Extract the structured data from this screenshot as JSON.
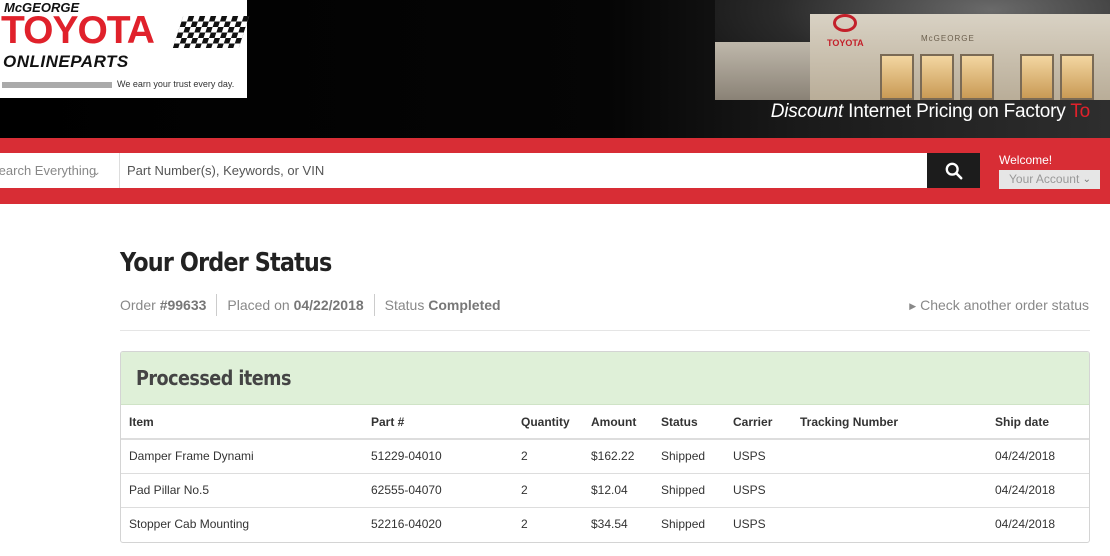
{
  "brand": {
    "dealer_name": "McGEORGE",
    "make": "TOYOTA",
    "site": "ONLINEPARTS",
    "tagline": "We earn your trust every day.",
    "building_sign": "TOYOTA",
    "building_sign_2": "McGEORGE"
  },
  "slogan": {
    "emphasis": "Discount",
    "text": " Internet Pricing on Factory ",
    "red_text": "To"
  },
  "search": {
    "category": "Search Everything",
    "placeholder": "Part Number(s), Keywords, or VIN",
    "button_icon": "search-icon"
  },
  "account": {
    "welcome": "Welcome!",
    "menu_label": "Your Account"
  },
  "page": {
    "title": "Your Order Status",
    "order_label": "Order ",
    "order_number": "#99633",
    "placed_label": "Placed on ",
    "placed_date": "04/22/2018",
    "status_label": "Status ",
    "status_value": "Completed",
    "check_link": "Check another order status"
  },
  "panel": {
    "title": "Processed items",
    "columns": [
      "Item",
      "Part #",
      "Quantity",
      "Amount",
      "Status",
      "Carrier",
      "Tracking Number",
      "Ship date"
    ],
    "rows": [
      [
        "Damper Frame Dynami",
        "51229-04010",
        "2",
        "$162.22",
        "Shipped",
        "USPS",
        "",
        "04/24/2018"
      ],
      [
        "Pad Pillar No.5",
        "62555-04070",
        "2",
        "$12.04",
        "Shipped",
        "USPS",
        "",
        "04/24/2018"
      ],
      [
        "Stopper Cab Mounting",
        "52216-04020",
        "2",
        "$34.54",
        "Shipped",
        "USPS",
        "",
        "04/24/2018"
      ]
    ]
  },
  "colors": {
    "brand_red": "#d82d35",
    "panel_green": "#dff0d8",
    "search_button": "#1c1c1c"
  }
}
